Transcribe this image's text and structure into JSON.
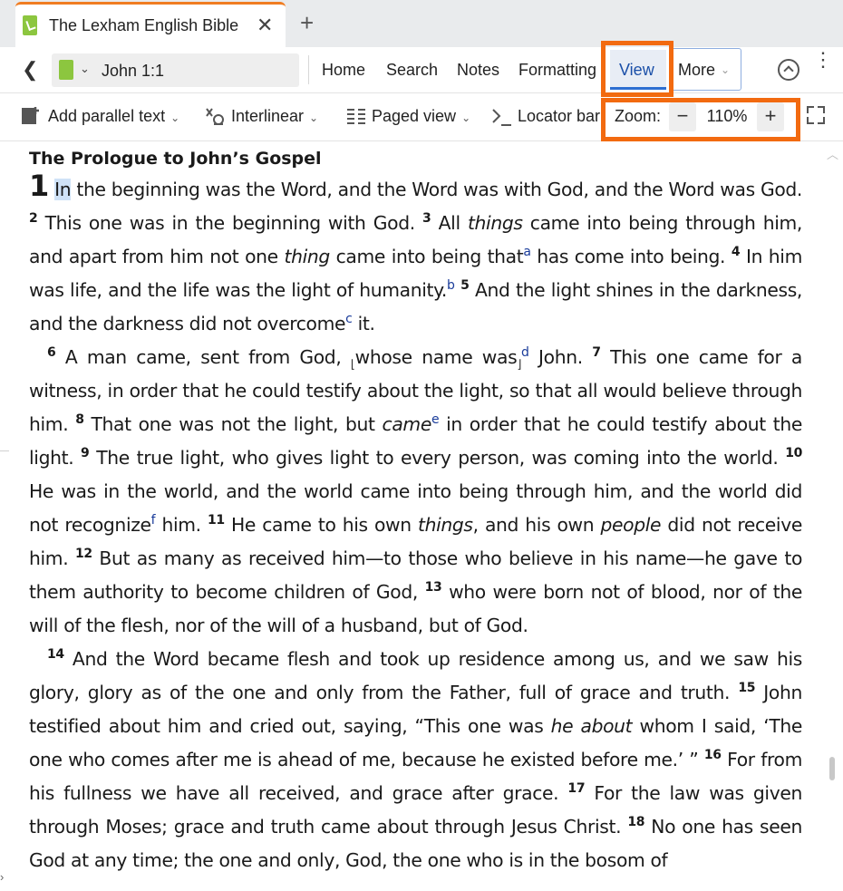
{
  "tab": {
    "title": "The Lexham English Bible",
    "close": "✕",
    "new": "+"
  },
  "nav": {
    "back": "❮",
    "reference": "John 1:1",
    "ref_chevron": "⌄",
    "menus": [
      "Home",
      "Search",
      "Notes",
      "Formatting"
    ],
    "view": "View",
    "more": "More",
    "more_chevron": "⌄",
    "kebab": "⋮"
  },
  "toolbar": {
    "parallel": "Add parallel text",
    "interlinear": "Interlinear",
    "paged": "Paged view",
    "locator": "Locator bar",
    "zoom_label": "Zoom:",
    "zoom_minus": "−",
    "zoom_value": "110%",
    "zoom_plus": "+"
  },
  "reader": {
    "heading": "The Prologue to John’s Gospel",
    "chapter": "1",
    "p1": {
      "sel": "In",
      "t1": " the beginning was the Word, and the Word was with God, and the Word was God. ",
      "v2": "2",
      "t2": " This one was in the beginning with God. ",
      "v3": "3",
      "t3a": " All ",
      "t3i": "things",
      "t3b": " came into being through him, and apart from him not one ",
      "t3i2": "thing",
      "t3c": " came into being that",
      "fa": "a",
      "t3d": " has come into being. ",
      "v4": "4",
      "t4": " In him was life, and the life was the light of humanity.",
      "fb": "b",
      "t4b": " ",
      "v5": "5",
      "t5": " And the light shines in the darkness, and the darkness did not overcome",
      "fc": "c",
      "t5b": " it."
    },
    "p2": {
      "v6": "6",
      "t6a": " A man came, sent from God, ",
      "br1": "⌊",
      "t6b": "whose name was",
      "br2": "⌋",
      "fd": "d",
      "t6c": " John. ",
      "v7": "7",
      "t7": " This one came for a witness, in order that he could testify about the light, so that all would believe through him. ",
      "v8": "8",
      "t8a": " That one was not the light, but ",
      "t8i": "came",
      "fe": "e",
      "t8b": " in order that he could testify about the light. ",
      "v9": "9",
      "t9": " The true light, who gives light to every person, was coming into the world. ",
      "v10": "10",
      "t10": " He was in the world, and the world came into being through him, and the world did not recognize",
      "ff": "f",
      "t10b": " him. ",
      "v11": "11",
      "t11a": " He came to his own ",
      "t11i": "things",
      "t11b": ", and his own ",
      "t11i2": "people",
      "t11c": " did not receive him. ",
      "v12": "12",
      "t12": " But as many as received him—to those who believe in his name—he gave to them authority to become children of God, ",
      "v13": "13",
      "t13": " who were born not of blood, nor of the will of the flesh, nor of the will of a husband, but of God."
    },
    "p3": {
      "v14": "14",
      "t14": " And the Word became flesh and took up residence among us, and we saw his glory, glory as of the one and only from the Father, full of grace and truth. ",
      "v15": "15",
      "t15a": " John testified about him and cried out, saying, “This one was ",
      "t15i": "he about",
      "t15b": " whom I said, ‘The one who comes after me is ahead of me, because he existed before me.’ ” ",
      "v16": "16",
      "t16": " For from his fullness we have all received, and grace after grace. ",
      "v17": "17",
      "t17": " For the law was given through Moses; grace and truth came about through Jesus Christ. ",
      "v18": "18",
      "t18": " No one has seen God at any time; the one and only, God, the one who is in the bosom of"
    }
  },
  "colors": {
    "accent": "#f26a10",
    "link": "#1a3c9a",
    "selection": "#cfe2f7",
    "book_icon": "#8cc63f"
  }
}
